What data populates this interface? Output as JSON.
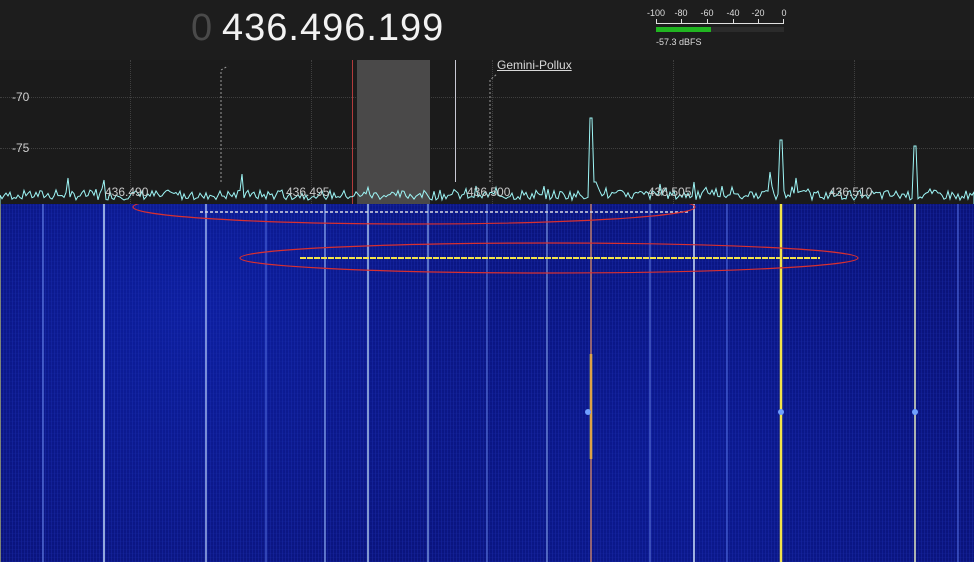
{
  "frequency": {
    "leading": "0",
    "display": "436.496.199"
  },
  "level_meter": {
    "scale": [
      "-100",
      "-80",
      "-60",
      "-40",
      "-20",
      "0"
    ],
    "value_text": "-57.3 dBFS",
    "level_dbfs": -57.3,
    "colors": {
      "bar": "#21b521"
    }
  },
  "spectrum": {
    "db_labels": [
      "-70",
      "-75"
    ],
    "freq_labels": [
      "436.490",
      "436.495",
      "436.500",
      "436.505",
      "436.510"
    ],
    "satellite_label": "Gemini-Pollux",
    "colors": {
      "trace": "#9ef6f6",
      "cursor": "#b23b3b",
      "passband": "#4a4949"
    }
  },
  "waterfall": {
    "colors": {
      "background": "#0a137a",
      "highlight_ellipse": "#d83030",
      "signal": "#f2e34a"
    }
  }
}
